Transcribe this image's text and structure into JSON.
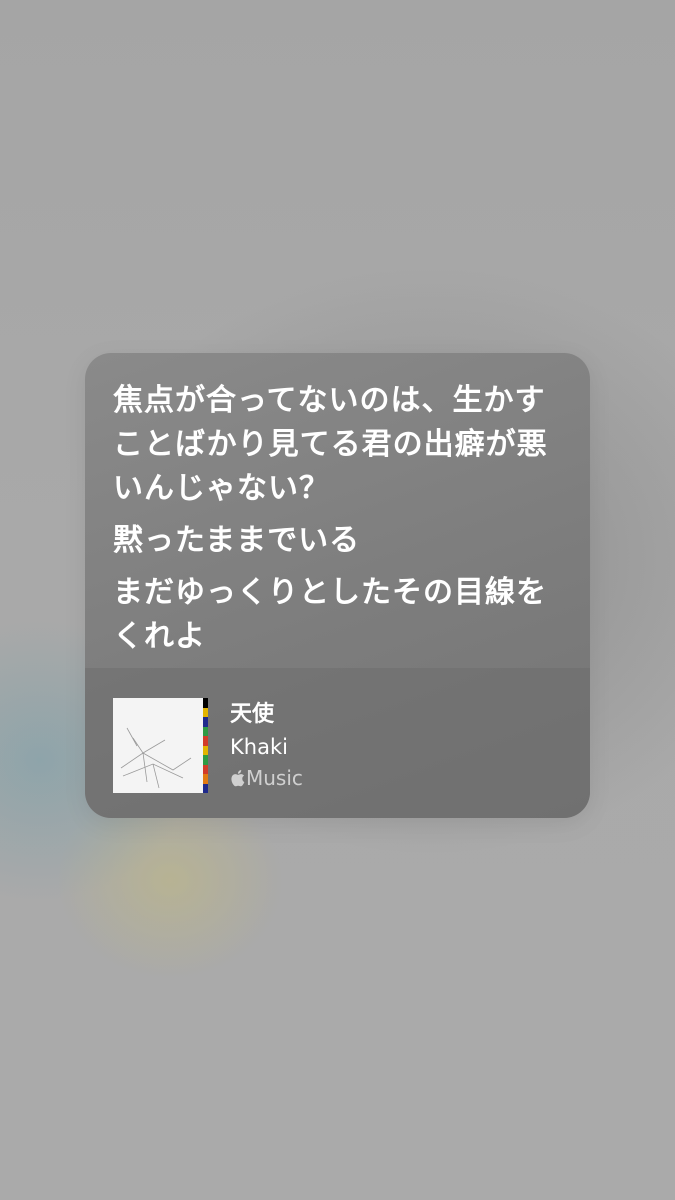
{
  "lyrics": {
    "lines": [
      "焦点が合ってないのは、生かすことばかり見てる君の出癖が悪いんじゃない？",
      "黙ったままでいる",
      "まだゆっくりとしたその目線をくれよ"
    ]
  },
  "track": {
    "title": "天使",
    "artist": "Khaki",
    "service": "Music",
    "service_icon": "apple-logo-icon"
  },
  "colors": {
    "background": "#a9a9a9",
    "card": "#7e7e7e",
    "text": "#ffffff"
  }
}
